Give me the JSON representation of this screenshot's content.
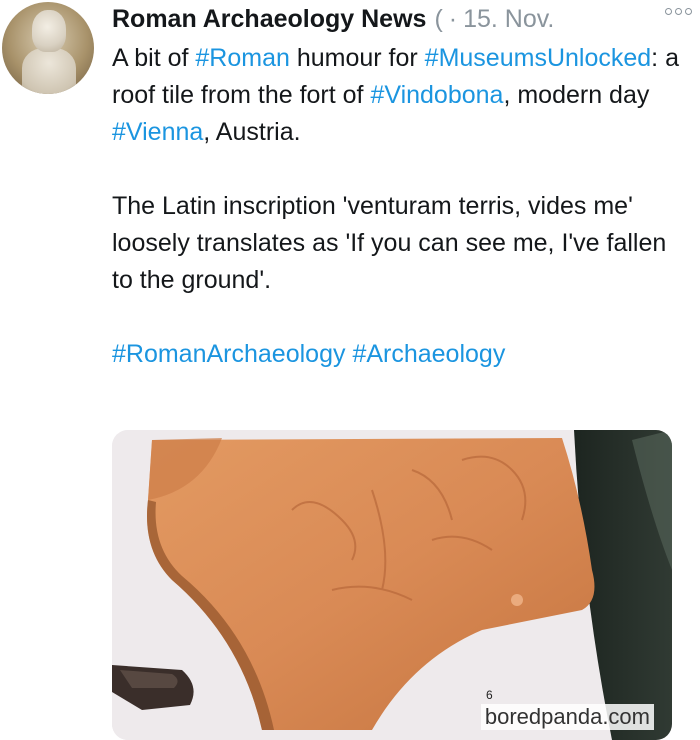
{
  "author": {
    "name": "Roman Archaeology News",
    "handle_fragment": "(",
    "separator": "·",
    "date": "15. Nov."
  },
  "menu_icon": "more-dots-icon",
  "tweet": {
    "p1": {
      "t1": "A bit of ",
      "tag1": "#Roman",
      "t2": " humour for ",
      "tag2": "#MuseumsUnlocked",
      "t3": ": a roof tile from the fort of ",
      "tag3": "#Vindobona",
      "t4": ", modern day ",
      "tag4": "#Vienna",
      "t5": ", Austria."
    },
    "p2": "The Latin inscription 'venturam terris, vides me' loosely translates as 'If you can see me, I've fallen to the ground'.",
    "hashtags": {
      "tag1": "#RomanArchaeology",
      "tag2": "#Archaeology"
    }
  },
  "media": {
    "label_number": "6",
    "watermark": "boredpanda.com"
  },
  "colors": {
    "link": "#1b95e0",
    "text": "#14171a",
    "muted": "#8a949c",
    "tile": "#d98a55"
  }
}
